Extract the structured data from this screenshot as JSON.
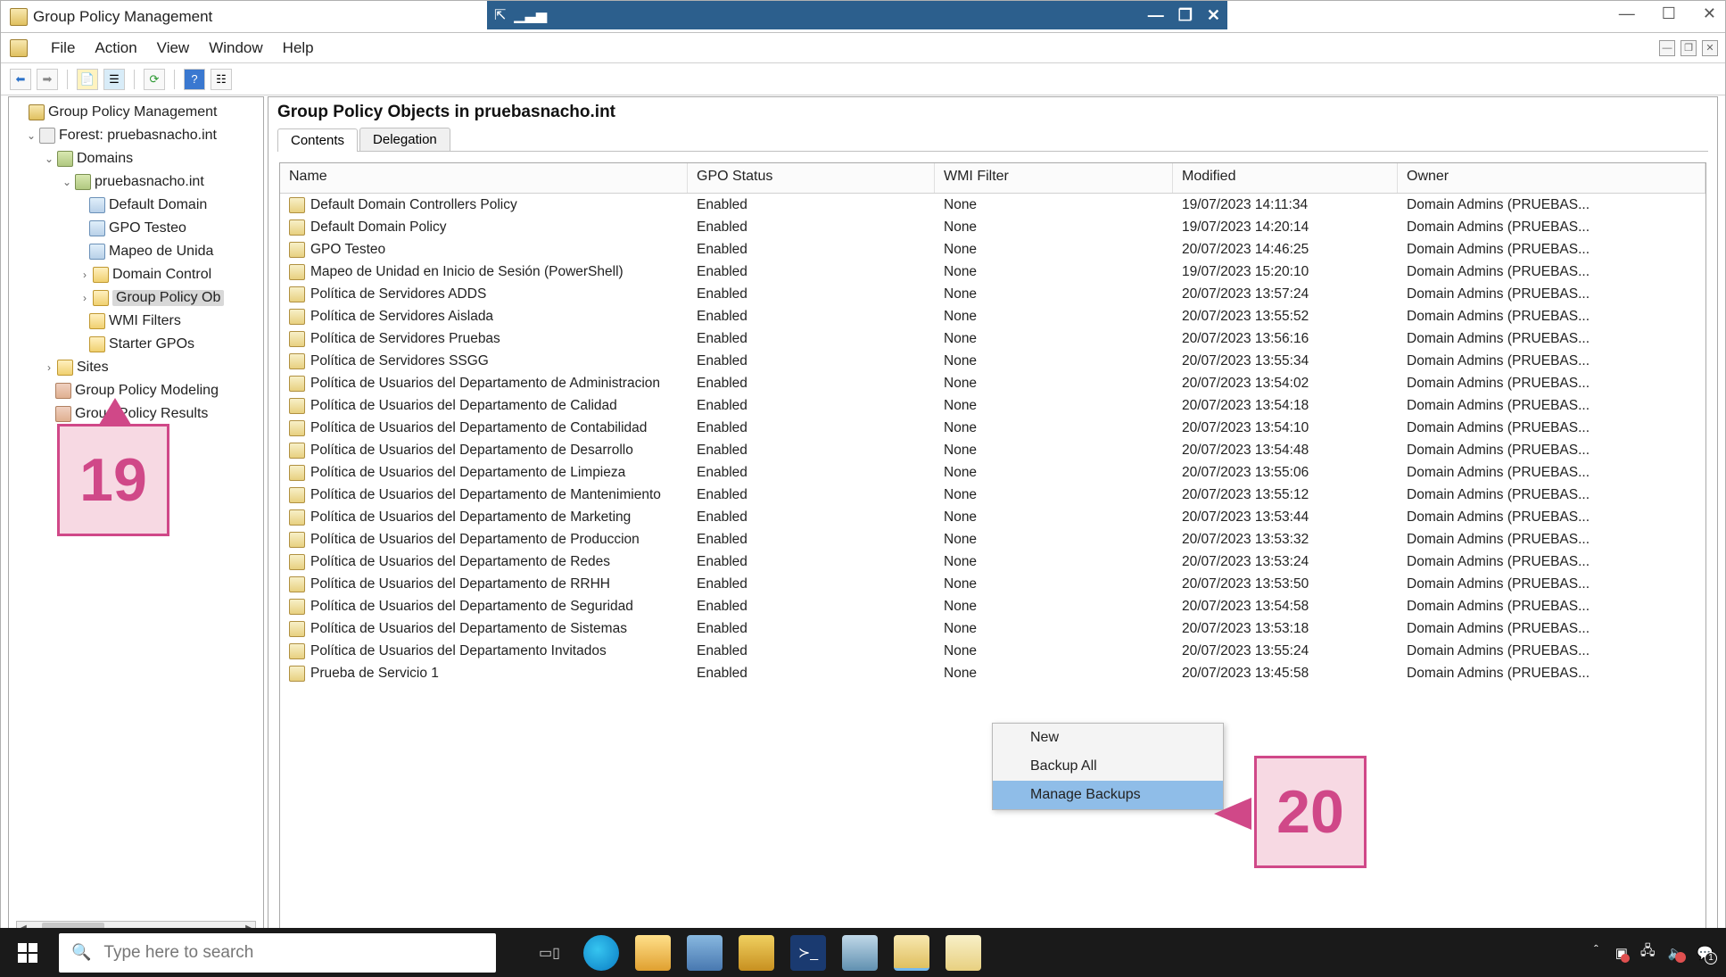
{
  "window": {
    "title": "Group Policy Management"
  },
  "menu": {
    "file": "File",
    "action": "Action",
    "view": "View",
    "window": "Window",
    "help": "Help"
  },
  "tree": {
    "root": "Group Policy Management",
    "forest": "Forest: pruebasnacho.int",
    "domains": "Domains",
    "domain": "pruebasnacho.int",
    "items": [
      "Default Domain",
      "GPO Testeo",
      "Mapeo de Unida",
      "Domain Control",
      "Group Policy Ob",
      "WMI Filters",
      "Starter GPOs"
    ],
    "sites": "Sites",
    "modeling": "Group Policy Modeling",
    "results": "Group Policy Results"
  },
  "content": {
    "title": "Group Policy Objects in pruebasnacho.int",
    "tabs": {
      "contents": "Contents",
      "delegation": "Delegation"
    },
    "columns": {
      "name": "Name",
      "status": "GPO Status",
      "wmi": "WMI Filter",
      "modified": "Modified",
      "owner": "Owner"
    },
    "rows": [
      {
        "name": "Default Domain Controllers Policy",
        "status": "Enabled",
        "wmi": "None",
        "modified": "19/07/2023 14:11:34",
        "owner": "Domain Admins (PRUEBAS..."
      },
      {
        "name": "Default Domain Policy",
        "status": "Enabled",
        "wmi": "None",
        "modified": "19/07/2023 14:20:14",
        "owner": "Domain Admins (PRUEBAS..."
      },
      {
        "name": "GPO Testeo",
        "status": "Enabled",
        "wmi": "None",
        "modified": "20/07/2023 14:46:25",
        "owner": "Domain Admins (PRUEBAS..."
      },
      {
        "name": "Mapeo de Unidad en Inicio de Sesión (PowerShell)",
        "status": "Enabled",
        "wmi": "None",
        "modified": "19/07/2023 15:20:10",
        "owner": "Domain Admins (PRUEBAS..."
      },
      {
        "name": "Política de Servidores ADDS",
        "status": "Enabled",
        "wmi": "None",
        "modified": "20/07/2023 13:57:24",
        "owner": "Domain Admins (PRUEBAS..."
      },
      {
        "name": "Política de Servidores Aislada",
        "status": "Enabled",
        "wmi": "None",
        "modified": "20/07/2023 13:55:52",
        "owner": "Domain Admins (PRUEBAS..."
      },
      {
        "name": "Política de Servidores Pruebas",
        "status": "Enabled",
        "wmi": "None",
        "modified": "20/07/2023 13:56:16",
        "owner": "Domain Admins (PRUEBAS..."
      },
      {
        "name": "Política de Servidores SSGG",
        "status": "Enabled",
        "wmi": "None",
        "modified": "20/07/2023 13:55:34",
        "owner": "Domain Admins (PRUEBAS..."
      },
      {
        "name": "Política de Usuarios del Departamento de Administracion",
        "status": "Enabled",
        "wmi": "None",
        "modified": "20/07/2023 13:54:02",
        "owner": "Domain Admins (PRUEBAS..."
      },
      {
        "name": "Política de Usuarios del Departamento de Calidad",
        "status": "Enabled",
        "wmi": "None",
        "modified": "20/07/2023 13:54:18",
        "owner": "Domain Admins (PRUEBAS..."
      },
      {
        "name": "Política de Usuarios del Departamento de Contabilidad",
        "status": "Enabled",
        "wmi": "None",
        "modified": "20/07/2023 13:54:10",
        "owner": "Domain Admins (PRUEBAS..."
      },
      {
        "name": "Política de Usuarios del Departamento de Desarrollo",
        "status": "Enabled",
        "wmi": "None",
        "modified": "20/07/2023 13:54:48",
        "owner": "Domain Admins (PRUEBAS..."
      },
      {
        "name": "Política de Usuarios del Departamento de Limpieza",
        "status": "Enabled",
        "wmi": "None",
        "modified": "20/07/2023 13:55:06",
        "owner": "Domain Admins (PRUEBAS..."
      },
      {
        "name": "Política de Usuarios del Departamento de Mantenimiento",
        "status": "Enabled",
        "wmi": "None",
        "modified": "20/07/2023 13:55:12",
        "owner": "Domain Admins (PRUEBAS..."
      },
      {
        "name": "Política de Usuarios del Departamento de Marketing",
        "status": "Enabled",
        "wmi": "None",
        "modified": "20/07/2023 13:53:44",
        "owner": "Domain Admins (PRUEBAS..."
      },
      {
        "name": "Política de Usuarios del Departamento de Produccion",
        "status": "Enabled",
        "wmi": "None",
        "modified": "20/07/2023 13:53:32",
        "owner": "Domain Admins (PRUEBAS..."
      },
      {
        "name": "Política de Usuarios del Departamento de Redes",
        "status": "Enabled",
        "wmi": "None",
        "modified": "20/07/2023 13:53:24",
        "owner": "Domain Admins (PRUEBAS..."
      },
      {
        "name": "Política de Usuarios del Departamento de RRHH",
        "status": "Enabled",
        "wmi": "None",
        "modified": "20/07/2023 13:53:50",
        "owner": "Domain Admins (PRUEBAS..."
      },
      {
        "name": "Política de Usuarios del Departamento de Seguridad",
        "status": "Enabled",
        "wmi": "None",
        "modified": "20/07/2023 13:54:58",
        "owner": "Domain Admins (PRUEBAS..."
      },
      {
        "name": "Política de Usuarios del Departamento de Sistemas",
        "status": "Enabled",
        "wmi": "None",
        "modified": "20/07/2023 13:53:18",
        "owner": "Domain Admins (PRUEBAS..."
      },
      {
        "name": "Política de Usuarios del Departamento Invitados",
        "status": "Enabled",
        "wmi": "None",
        "modified": "20/07/2023 13:55:24",
        "owner": "Domain Admins (PRUEBAS..."
      },
      {
        "name": "Prueba de Servicio 1",
        "status": "Enabled",
        "wmi": "None",
        "modified": "20/07/2023 13:45:58",
        "owner": "Domain Admins (PRUEBAS..."
      }
    ]
  },
  "context_menu": {
    "new": "New",
    "backup_all": "Backup All",
    "manage_backups": "Manage Backups"
  },
  "callouts": {
    "c19": "19",
    "c20": "20"
  },
  "taskbar": {
    "search_placeholder": "Type here to search"
  }
}
